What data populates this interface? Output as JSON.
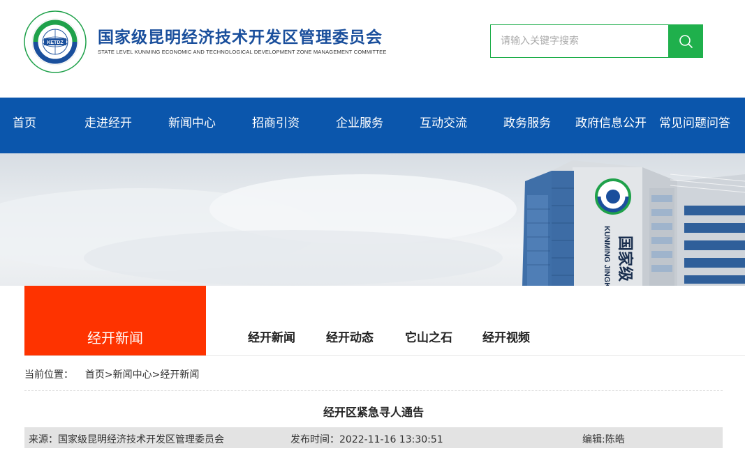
{
  "header": {
    "title": "国家级昆明经济技术开发区管理委员会",
    "subtitle": "STATE LEVEL KUNMING ECONOMIC AND TECHNOLOGICAL DEVELOPMENT ZONE MANAGEMENT COMMITTEE",
    "logo_text": "KETDZ",
    "logo_ring_text": "中国国家级经济技术开发区 KUNMING ECONOMIC AND TECHNOLOGICAL DEVELOPMENT ZONE",
    "search_placeholder": "请输入关键字搜索"
  },
  "nav": {
    "items": [
      "首页",
      "走进经开",
      "新闻中心",
      "招商引资",
      "企业服务",
      "互动交流",
      "政务服务",
      "政府信息公开",
      "常见问题问答"
    ]
  },
  "banner": {
    "building_sign": "KUNMING JINGKAI",
    "building_sign_cn": "国家级"
  },
  "section": {
    "current_column": "经开新闻",
    "subnav": [
      "经开新闻",
      "经开动态",
      "它山之石",
      "经开视频"
    ]
  },
  "breadcrumb": {
    "label": "当前位置：",
    "items": [
      "首页",
      "新闻中心",
      "经开新闻"
    ],
    "sep": ">"
  },
  "article": {
    "title": "经开区紧急寻人通告",
    "source": "来源：国家级昆明经济技术开发区管理委员会",
    "publish_time": "发布时间：2022-11-16 13:30:51",
    "editor": "编辑:陈皓"
  },
  "colors": {
    "nav_bg": "#0b56ac",
    "accent_green": "#1fb04c",
    "column_tab": "#fe3300",
    "title_blue": "#1a4f9c"
  },
  "icons": {
    "search": "search-icon",
    "logo": "logo-icon"
  }
}
